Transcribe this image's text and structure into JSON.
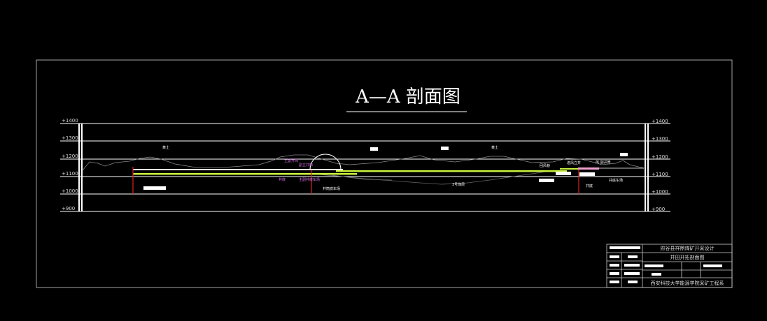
{
  "drawing": {
    "title": "A—A 剖面图",
    "elevation_ticks": [
      "+1400",
      "+1300",
      "+1200",
      "+1100",
      "+1000",
      "+900"
    ],
    "labels": {
      "loess_left": "黄土",
      "loess_right": "黄土",
      "main_shaft_top": "主副井筒",
      "aux_shaft_top": "副立井筒",
      "shaft_bottom": "井底",
      "main_shaft_bottom": "主副井底车场",
      "shaft_station_left": "井筒底车场",
      "coal_seam": "3号煤层",
      "return_ramp": "回风巷",
      "air_shaft": "进风立井",
      "vent_shaft_top": "风 副井筒",
      "shaft_bottom_right": "井底",
      "bottom_station_right": "井底车场"
    }
  },
  "title_block": {
    "project": "府谷县祥鼎煤矿开采设计",
    "drawing_name": "井田开拓剖面图",
    "organization": "西安科技大学能源学院采矿工程系"
  },
  "colors": {
    "background": "#000000",
    "line": "#ffffff",
    "coal_seam": "#c8f03c",
    "shaft": "#e02020",
    "annotation": "#d070e0",
    "terrain": "#888888"
  }
}
